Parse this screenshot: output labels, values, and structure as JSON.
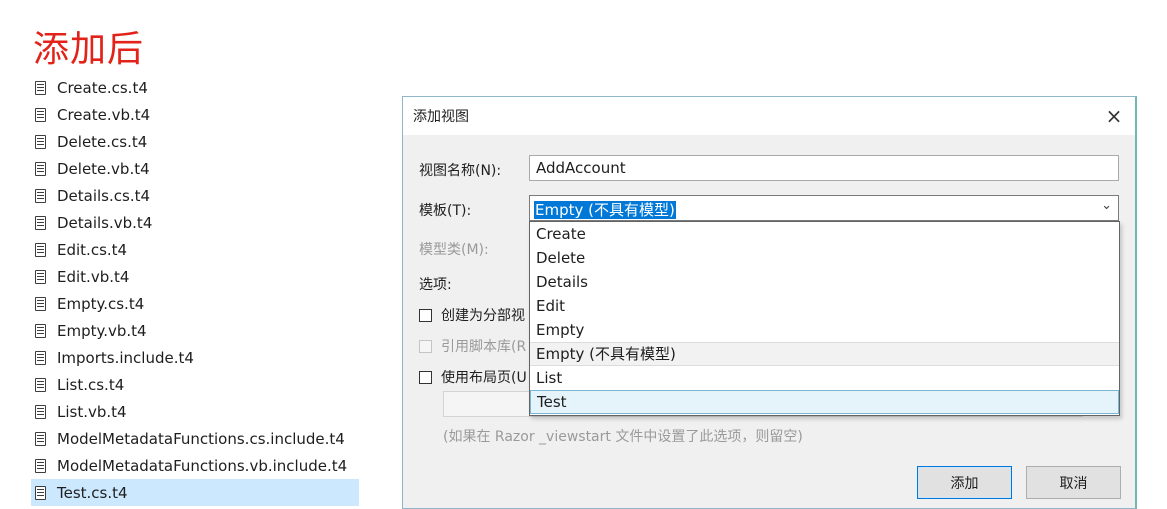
{
  "page_title": "添加后",
  "files": [
    "Create.cs.t4",
    "Create.vb.t4",
    "Delete.cs.t4",
    "Delete.vb.t4",
    "Details.cs.t4",
    "Details.vb.t4",
    "Edit.cs.t4",
    "Edit.vb.t4",
    "Empty.cs.t4",
    "Empty.vb.t4",
    "Imports.include.t4",
    "List.cs.t4",
    "List.vb.t4",
    "ModelMetadataFunctions.cs.include.t4",
    "ModelMetadataFunctions.vb.include.t4",
    "Test.cs.t4"
  ],
  "selected_file": "Test.cs.t4",
  "dialog": {
    "title": "添加视图",
    "close_icon": "×",
    "view_name_label": "视图名称(N):",
    "view_name_value": "AddAccount",
    "template_label": "模板(T):",
    "template_value": "Empty (不具有模型)",
    "template_chevron": "⌄",
    "model_class_label": "模型类(M):",
    "options_label": "选项:",
    "partial_view_label": "创建为分部视",
    "script_lib_label": "引用脚本库(R",
    "layout_page_label": "使用布局页(U",
    "hint": "(如果在 Razor _viewstart 文件中设置了此选项，则留空)",
    "add_button": "添加",
    "cancel_button": "取消",
    "template_options": [
      "Create",
      "Delete",
      "Details",
      "Edit",
      "Empty",
      "Empty (不具有模型)",
      "List",
      "Test"
    ],
    "current_option": "Empty (不具有模型)",
    "hover_option": "Test"
  }
}
